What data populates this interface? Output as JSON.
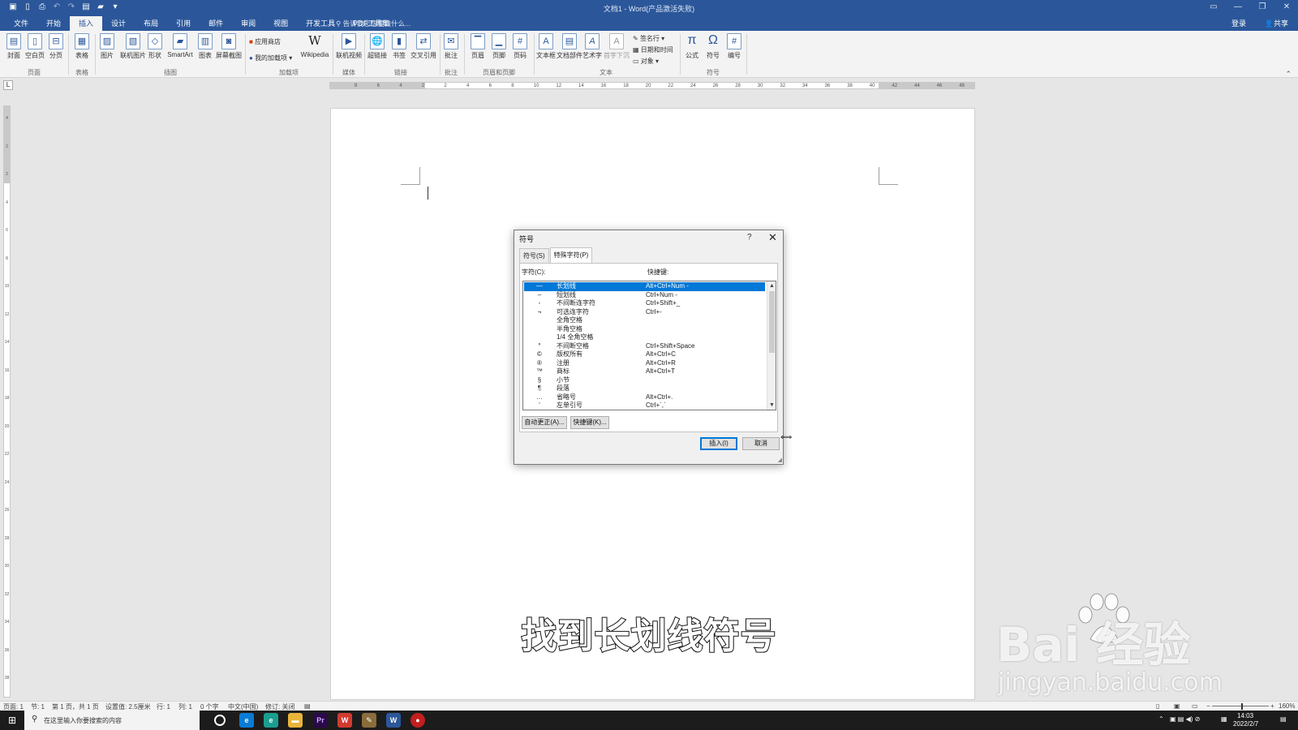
{
  "window": {
    "title": "文档1 - Word(产品激活失败)",
    "qat_icons": [
      "save-icon",
      "new-doc-icon",
      "print-preview-icon",
      "undo-icon",
      "redo-icon",
      "format-icon",
      "open-icon",
      "customize-icon"
    ],
    "controls": [
      "ribbon-display-icon",
      "minimize-icon",
      "restore-icon",
      "close-icon"
    ]
  },
  "tabs": [
    "文件",
    "开始",
    "插入",
    "设计",
    "布局",
    "引用",
    "邮件",
    "审阅",
    "视图",
    "开发工具",
    "PDF工具集"
  ],
  "active_tab": "插入",
  "tell_me": "告诉我您想要做什么...",
  "account": {
    "login": "登录",
    "share": "共享"
  },
  "ribbon": {
    "pages_group": {
      "label": "页面",
      "cover": "封面",
      "blank": "空白页",
      "break": "分页"
    },
    "table_group": {
      "label": "表格",
      "table": "表格"
    },
    "illustrations_group": {
      "label": "插图",
      "picture": "图片",
      "online_picture": "联机图片",
      "shapes": "形状",
      "smartart": "SmartArt",
      "chart": "图表",
      "screenshot": "屏幕截图"
    },
    "addins_group": {
      "label": "加载项",
      "store": "应用商店",
      "my_addins": "我的加载项",
      "wikipedia": "Wikipedia"
    },
    "media_group": {
      "label": "媒体",
      "online_video": "联机视频"
    },
    "links_group": {
      "label": "链接",
      "hyperlink": "超链接",
      "bookmark": "书签",
      "cross_ref": "交叉引用"
    },
    "comments_group": {
      "label": "批注",
      "comment": "批注"
    },
    "header_footer_group": {
      "label": "页眉和页脚",
      "header": "页眉",
      "footer": "页脚",
      "page_number": "页码"
    },
    "text_group": {
      "label": "文本",
      "text_box": "文本框",
      "quick_parts": "文档部件",
      "wordart": "艺术字",
      "drop_cap": "首字下沉",
      "signature_line": "签名行",
      "date_time": "日期和时间",
      "object": "对象"
    },
    "symbols_group": {
      "label": "符号",
      "equation": "公式",
      "symbol": "符号",
      "number": "编号"
    }
  },
  "ruler": {
    "h_ticks": [
      "8",
      "6",
      "4",
      "2",
      "2",
      "4",
      "6",
      "8",
      "10",
      "12",
      "14",
      "16",
      "18",
      "20",
      "22",
      "24",
      "26",
      "28",
      "30",
      "32",
      "34",
      "36",
      "38",
      "40",
      "42",
      "44",
      "46",
      "48"
    ],
    "v_ticks": [
      "4",
      "2",
      "2",
      "4",
      "6",
      "8",
      "10",
      "12",
      "14",
      "16",
      "18",
      "20",
      "22",
      "24",
      "26",
      "28",
      "30",
      "32",
      "34",
      "36",
      "38"
    ]
  },
  "dialog": {
    "title": "符号",
    "help": "?",
    "tabs": [
      "符号(S)",
      "特殊字符(P)"
    ],
    "active_tab": "特殊字符(P)",
    "col_char": "字符(C):",
    "col_shortcut": "快捷键:",
    "rows": [
      {
        "sym": "—",
        "name": "长划线",
        "key": "Alt+Ctrl+Num -",
        "selected": true
      },
      {
        "sym": "–",
        "name": "短划线",
        "key": "Ctrl+Num -"
      },
      {
        "sym": "-",
        "name": "不间断连字符",
        "key": "Ctrl+Shift+_"
      },
      {
        "sym": "¬",
        "name": "可选连字符",
        "key": "Ctrl+-"
      },
      {
        "sym": "",
        "name": "全角空格",
        "key": ""
      },
      {
        "sym": "",
        "name": "半角空格",
        "key": ""
      },
      {
        "sym": "",
        "name": "1/4 全角空格",
        "key": ""
      },
      {
        "sym": "°",
        "name": "不间断空格",
        "key": "Ctrl+Shift+Space"
      },
      {
        "sym": "©",
        "name": "版权所有",
        "key": "Alt+Ctrl+C"
      },
      {
        "sym": "®",
        "name": "注册",
        "key": "Alt+Ctrl+R"
      },
      {
        "sym": "™",
        "name": "商标",
        "key": "Alt+Ctrl+T"
      },
      {
        "sym": "§",
        "name": "小节",
        "key": ""
      },
      {
        "sym": "¶",
        "name": "段落",
        "key": ""
      },
      {
        "sym": "…",
        "name": "省略号",
        "key": "Alt+Ctrl+."
      },
      {
        "sym": "'",
        "name": "左单引号",
        "key": "Ctrl+`,`"
      }
    ],
    "autocorrect_btn": "自动更正(A)...",
    "shortcut_btn": "快捷键(K)...",
    "insert_btn": "插入(I)",
    "cancel_btn": "取消"
  },
  "caption": "找到长划线符号",
  "watermark": {
    "logo": "Bai  经验",
    "site": "jingyan.baidu.com"
  },
  "status": {
    "page": "页面: 1",
    "section": "节: 1",
    "page_of": "第 1 页，共 1 页",
    "position": "设置值: 2.5厘米",
    "line": "行: 1",
    "column": "列: 1",
    "words": "0 个字",
    "language": "中文(中国)",
    "track": "修订: 关闭",
    "zoom": "160%"
  },
  "taskbar": {
    "search_placeholder": "在这里输入你要搜索的内容",
    "time": "14:03",
    "date": "2022/2/7"
  },
  "colors": {
    "word_blue": "#2b579a",
    "selection": "#0078d7"
  }
}
